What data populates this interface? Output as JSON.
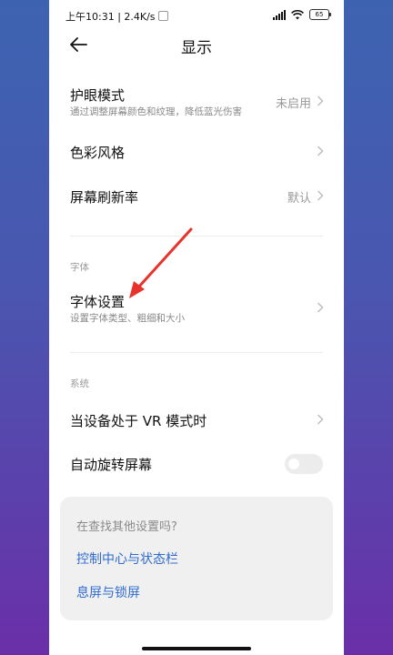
{
  "status_bar": {
    "time_speed": "上午10:31 | 2.4K/s",
    "battery": "65"
  },
  "header": {
    "title": "显示",
    "back_icon": "arrow-left-icon"
  },
  "rows": {
    "eye_mode": {
      "label": "护眼模式",
      "subtitle": "通过调整屏幕颜色和纹理，降低蓝光伤害",
      "value": "未启用"
    },
    "color_style": {
      "label": "色彩风格"
    },
    "refresh_rate": {
      "label": "屏幕刷新率",
      "value": "默认"
    },
    "font_section": "字体",
    "font_settings": {
      "label": "字体设置",
      "subtitle": "设置字体类型、粗细和大小"
    },
    "system_section": "系统",
    "vr_mode": {
      "label": "当设备处于 VR 模式时"
    },
    "auto_rotate": {
      "label": "自动旋转屏幕",
      "enabled": false
    }
  },
  "suggestions": {
    "question": "在查找其他设置吗?",
    "links": [
      "控制中心与状态栏",
      "息屏与锁屏"
    ]
  },
  "colors": {
    "accent_link": "#2f6bd0",
    "annotation_arrow": "#e8322b"
  }
}
